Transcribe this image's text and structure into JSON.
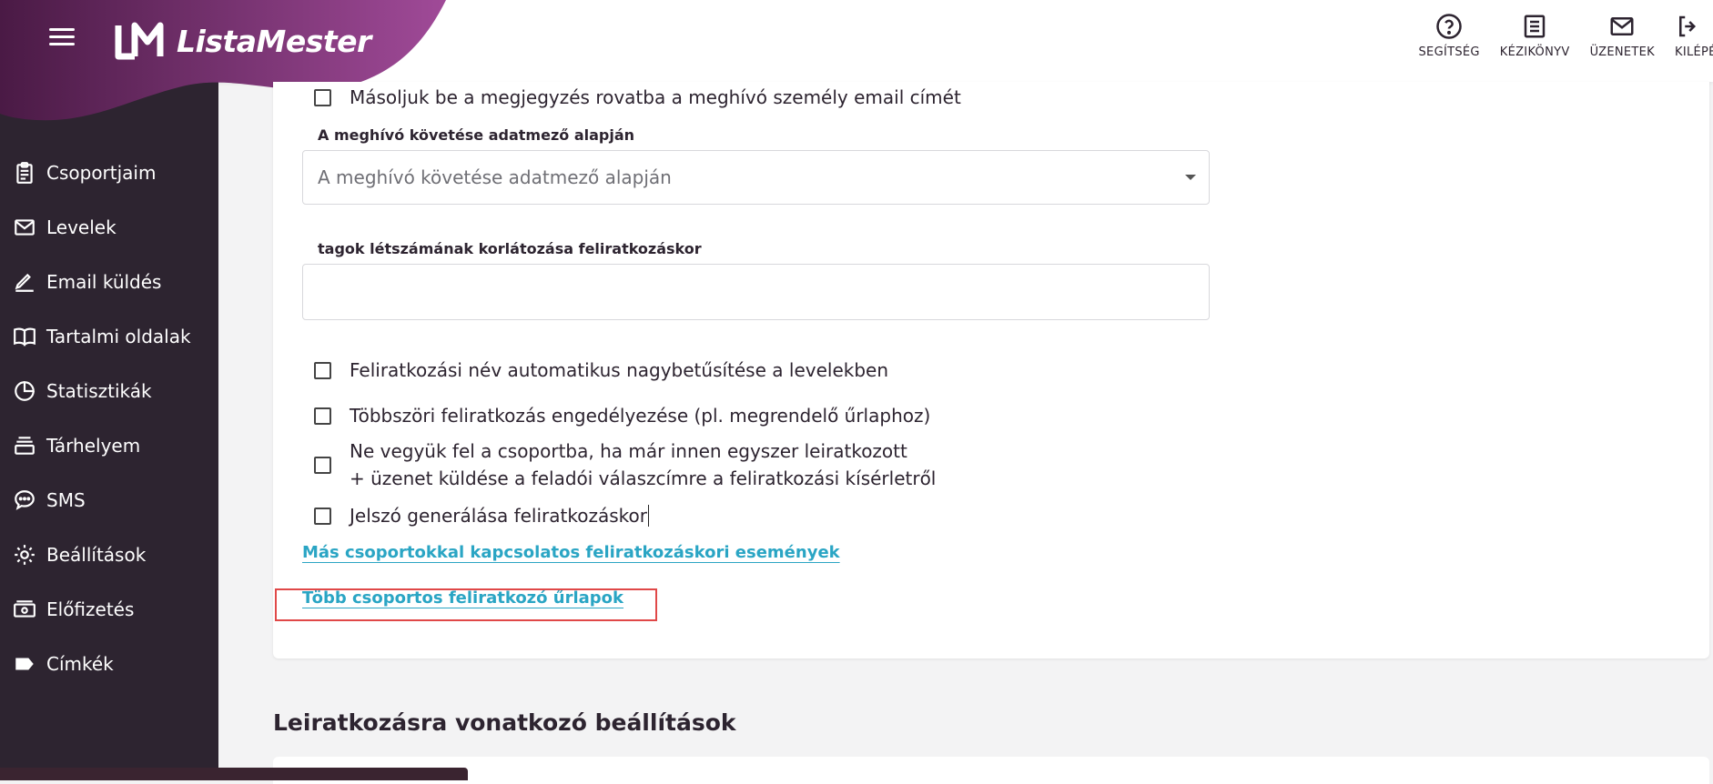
{
  "app": {
    "name": "ListaMester",
    "brand_color": "#8e3a84",
    "sidebar_color": "#2d2430",
    "link_color": "#2aa5c4"
  },
  "topbar": {
    "actions": [
      {
        "label": "SEGÍTSÉG",
        "icon": "help-circle-icon"
      },
      {
        "label": "KÉZIKÖNYV",
        "icon": "manual-list-icon"
      },
      {
        "label": "ÜZENETEK",
        "icon": "envelope-icon"
      },
      {
        "label": "KILÉPÉS",
        "icon": "logout-icon"
      }
    ]
  },
  "sidebar": {
    "items": [
      {
        "label": "Csoportjaim",
        "icon": "clipboard-icon"
      },
      {
        "label": "Levelek",
        "icon": "envelope-icon"
      },
      {
        "label": "Email küldés",
        "icon": "pen-icon"
      },
      {
        "label": "Tartalmi oldalak",
        "icon": "book-icon"
      },
      {
        "label": "Statisztikák",
        "icon": "pie-chart-icon"
      },
      {
        "label": "Tárhelyem",
        "icon": "storage-icon"
      },
      {
        "label": "SMS",
        "icon": "sms-bubble-icon"
      },
      {
        "label": "Beállítások",
        "icon": "gear-icon"
      },
      {
        "label": "Előfizetés",
        "icon": "money-icon"
      },
      {
        "label": "Címkék",
        "icon": "tag-icon"
      }
    ]
  },
  "form": {
    "copy_email_label": "Másoljuk be a megjegyzés rovatba a meghívó személy email címét",
    "follow_field_label": "A meghívó követése adatmező alapján",
    "follow_field_placeholder": "A meghívó követése adatmező alapján",
    "member_limit_label": "tagok létszámának korlátozása feliratkozáskor",
    "member_limit_value": "",
    "checkboxes": [
      {
        "label": "Feliratkozási név automatikus nagybetűsítése a levelekben",
        "checked": false
      },
      {
        "label": "Többszöri feliratkozás engedélyezése (pl. megrendelő űrlaphoz)",
        "checked": false
      },
      {
        "label_line1": "Ne vegyük fel a csoportba, ha már innen egyszer leiratkozott",
        "label_line2": "+ üzenet küldése a feladói válaszcímre a feliratkozási kísérletről",
        "checked": false
      },
      {
        "label": "Jelszó generálása feliratkozáskor",
        "checked": false
      }
    ],
    "link_other_groups": "Más csoportokkal kapcsolatos feliratkozáskori események",
    "link_multi_group_forms": "Több csoportos feliratkozó űrlapok"
  },
  "unsubscribe_section": {
    "title": "Leiratkozásra vonatkozó beállítások"
  }
}
